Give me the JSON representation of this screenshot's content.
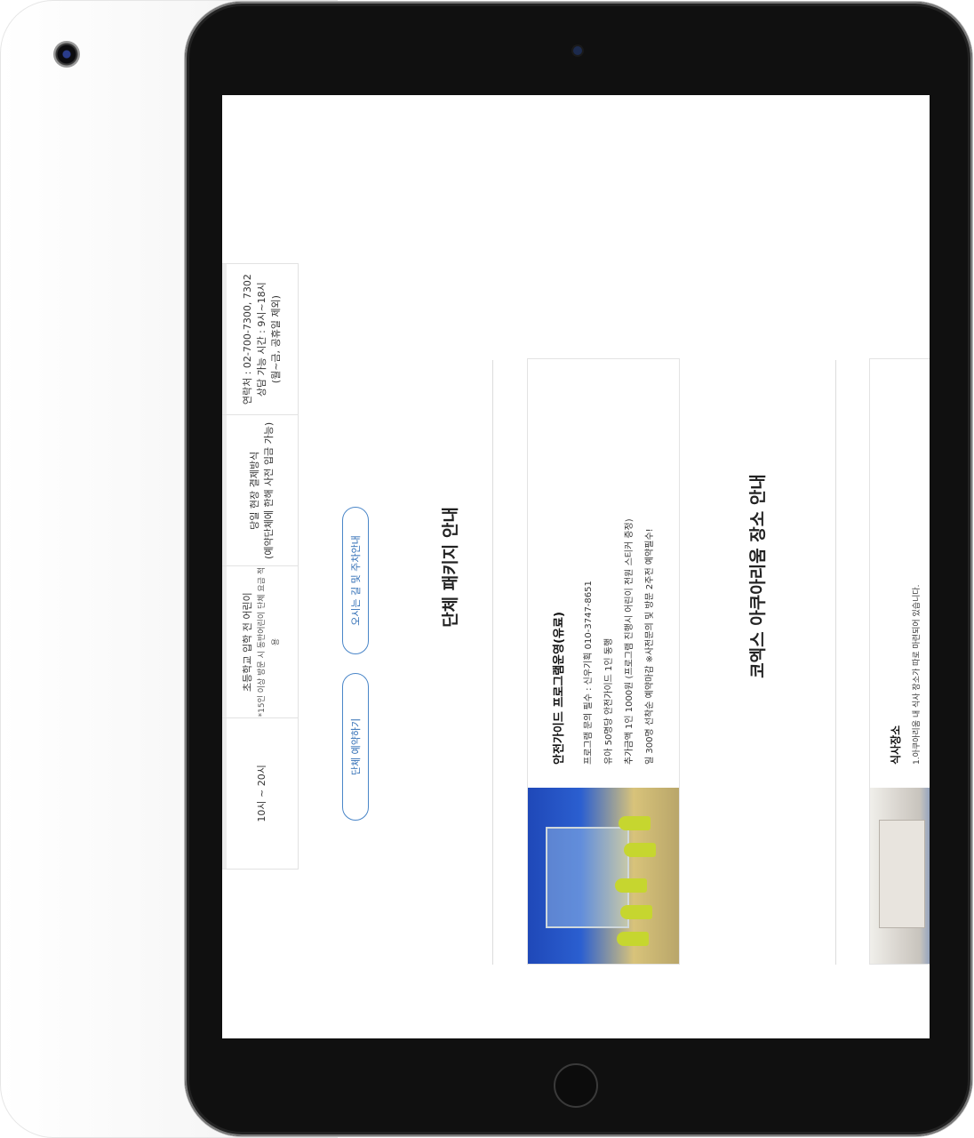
{
  "info_table": {
    "cells": [
      {
        "text": "10시 ~ 20시"
      },
      {
        "text": "초등학교 입학 전 어린이",
        "note": "*15인 이상 방문 시 동반어린이 단체 요금 적용"
      },
      {
        "text": "당일 현장 결제방식",
        "note": "(예약단체에 한해 사전 입금 가능)"
      },
      {
        "text": "연락처 : 02-700-7300, 7302",
        "line2": "상담 가능 시간 : 9시~18시",
        "line3": "(월~금, 공휴일 제외)"
      }
    ]
  },
  "buttons": {
    "reserve": "단체 예약하기",
    "directions": "오시는 길 및 주차안내"
  },
  "sections": {
    "package_title": "단체 패키지 안내",
    "places_title": "코엑스 아쿠아리움 장소 안내"
  },
  "guide_card": {
    "title": "안전가이드 프로그램운영(유료)",
    "lines": [
      "프로그램 문의 필수 : 신우기획 010-3747-8651",
      "유아 50명당 안전가이드 1인 동행",
      "추가금액 1인 1000원 (프로그램 진행시 어린이 전원 스티커 증정)",
      "일 300명 선착순 예약마감 ※사전문의 및 방문 2주전 예약필수!"
    ]
  },
  "place_card": {
    "title": "식사장소",
    "text": "1.아쿠아리움 내 식사 장소가 따로 마련되어 있습니다."
  }
}
